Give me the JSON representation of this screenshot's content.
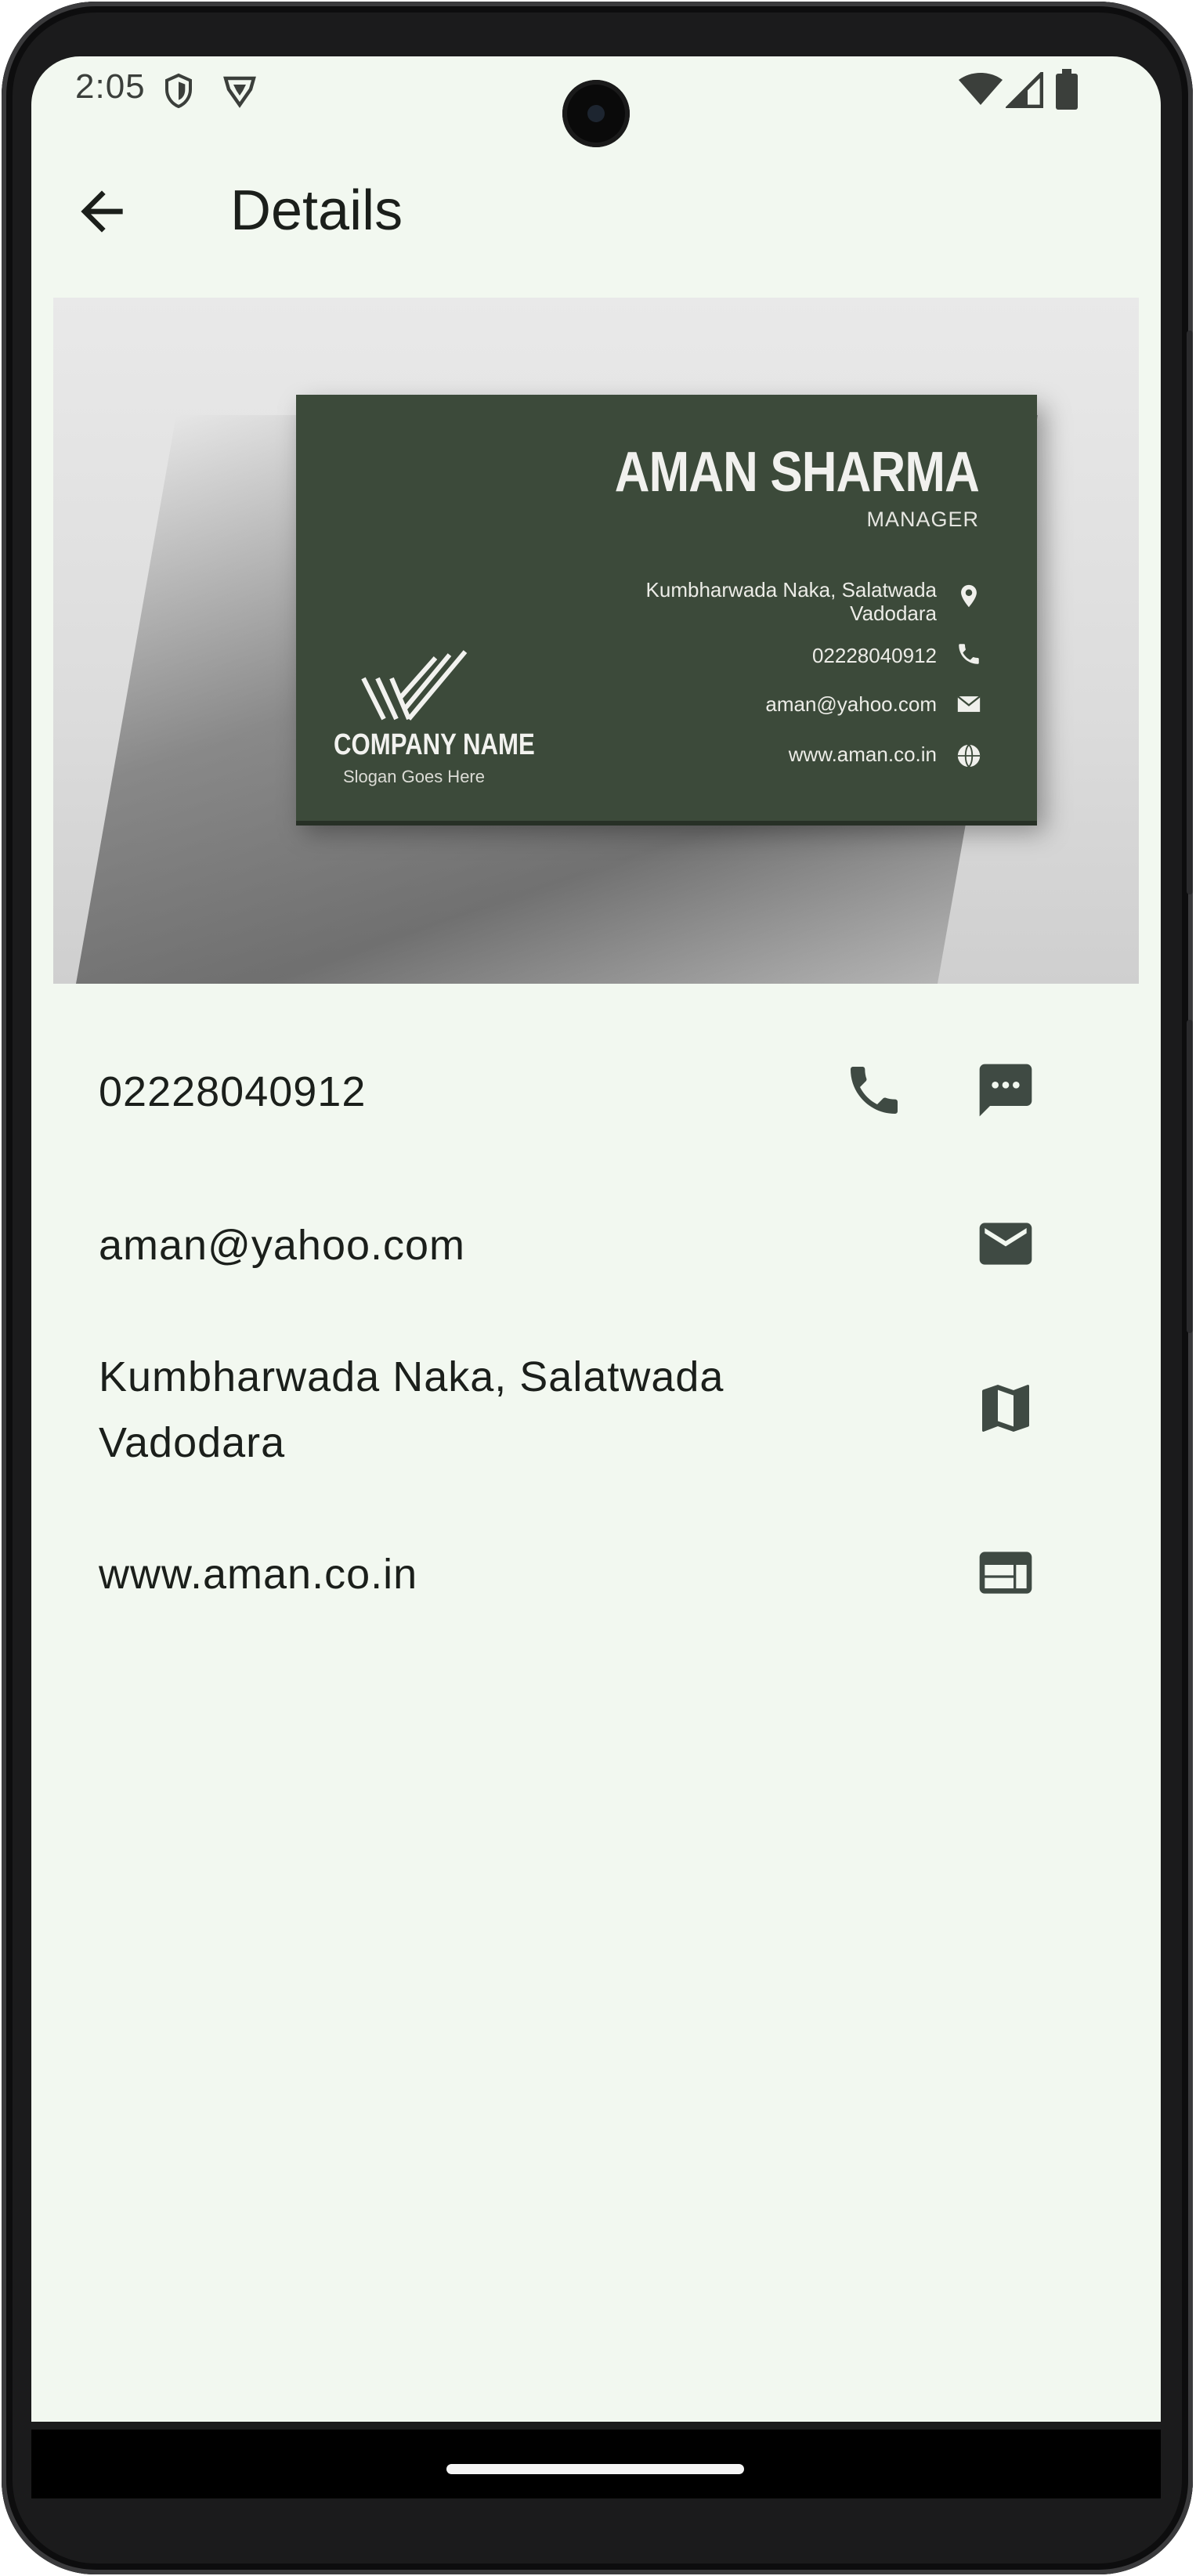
{
  "status_bar": {
    "time": "2:05",
    "left_icons": [
      "shield-icon",
      "brave-lion-icon"
    ],
    "right_icons": [
      "wifi-icon",
      "cell-signal-icon",
      "battery-icon"
    ]
  },
  "app_bar": {
    "title": "Details",
    "back_icon": "arrow-back-icon"
  },
  "card_image": {
    "name": "AMAN SHARMA",
    "role": "MANAGER",
    "address_line1": "Kumbharwada Naka, Salatwada",
    "address_line2": "Vadodara",
    "phone": "02228040912",
    "email": "aman@yahoo.com",
    "website": "www.aman.co.in",
    "company": "COMPANY NAME",
    "slogan": "Slogan Goes Here",
    "card_color": "#3c4a3a"
  },
  "contacts": {
    "phone": {
      "value": "02228040912",
      "call_icon": "phone-icon",
      "message_icon": "message-icon"
    },
    "email": {
      "value": "aman@yahoo.com",
      "icon": "mail-icon"
    },
    "address": {
      "line1": "Kumbharwada Naka, Salatwada",
      "line2": "Vadodara",
      "icon": "map-icon"
    },
    "website": {
      "value": "www.aman.co.in",
      "icon": "web-icon"
    }
  },
  "colors": {
    "background": "#f2f8f0",
    "text": "#1b1f1b",
    "icon": "#3f4a43"
  }
}
